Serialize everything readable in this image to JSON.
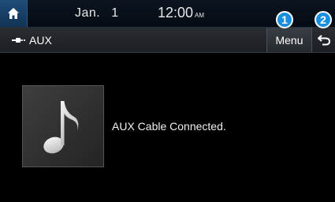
{
  "status_bar": {
    "month": "Jan.",
    "day": "1",
    "time": "12:00",
    "ampm": "AM"
  },
  "title_bar": {
    "source_title": "AUX",
    "menu_label": "Menu"
  },
  "callouts": {
    "one": "1",
    "two": "2"
  },
  "main": {
    "status_message": "AUX Cable Connected."
  },
  "icons": {
    "home": "home-icon",
    "plug": "aux-plug-icon",
    "back": "back-arrow-icon",
    "album": "music-note-icon"
  },
  "colors": {
    "accent": "#1a8fe0",
    "home_button": "#1f4c7a",
    "background": "#000000"
  }
}
